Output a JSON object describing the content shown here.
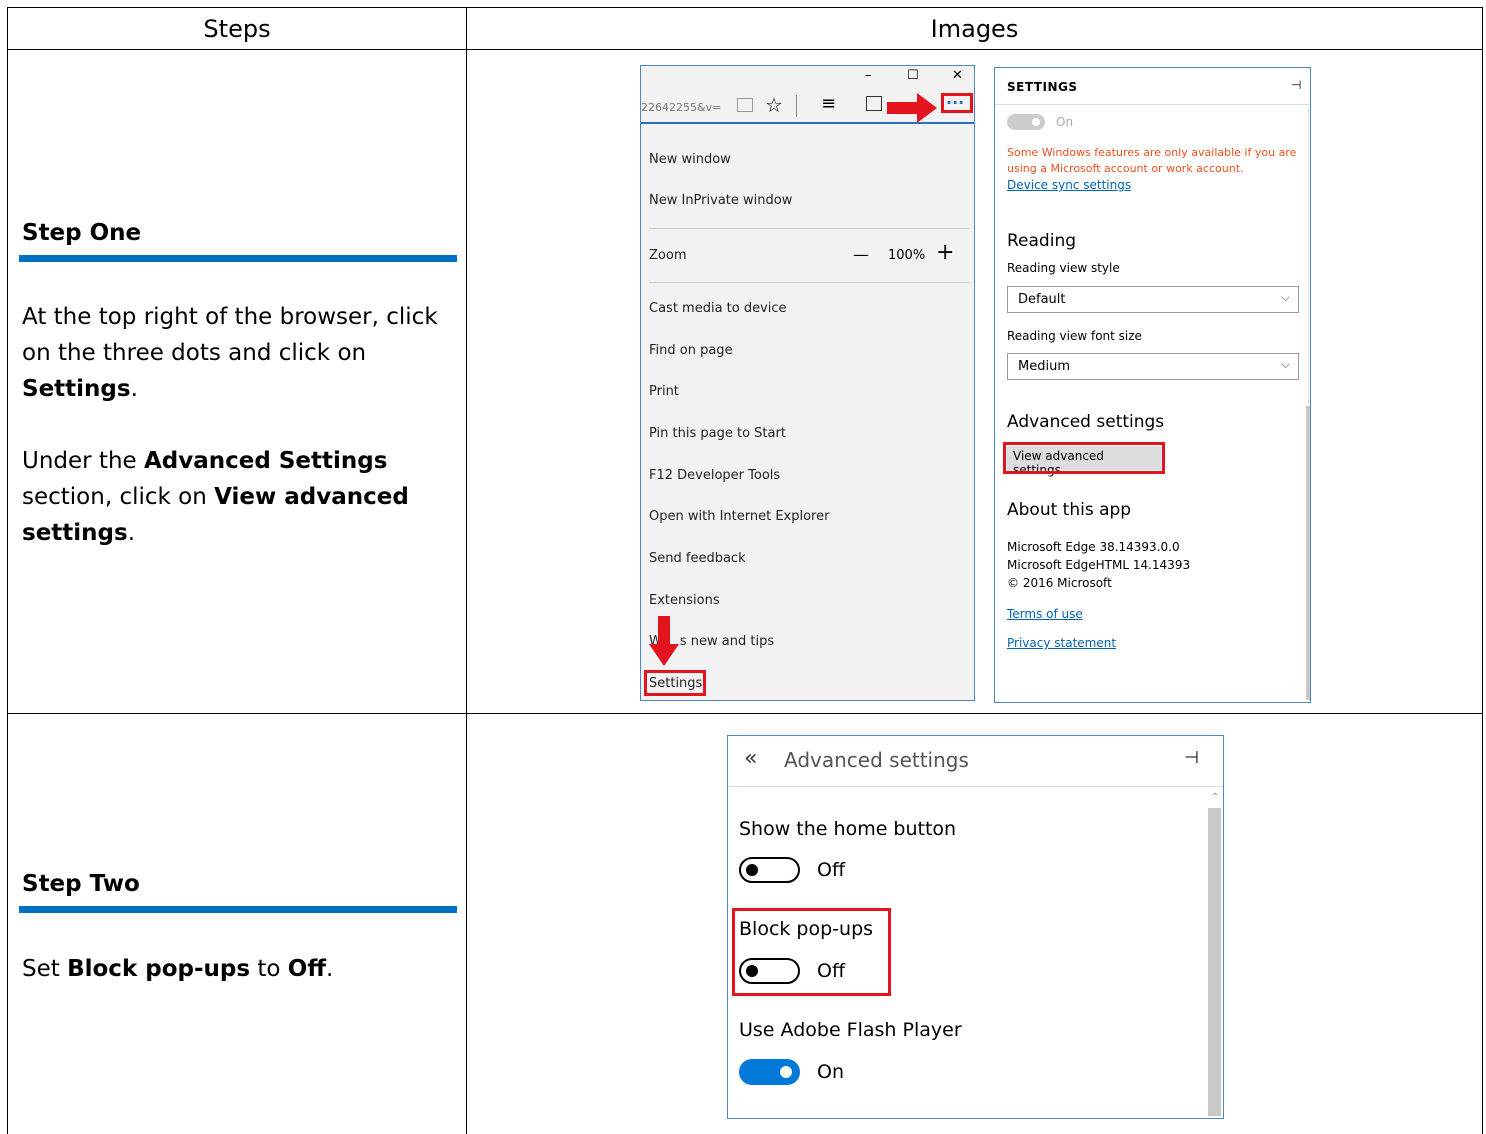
{
  "table": {
    "headers": [
      "Steps",
      "Images"
    ]
  },
  "step_one": {
    "heading": "Step One",
    "p1_pre": "At the top right of the browser, click on the three dots and click on ",
    "p1_bold": "Settings",
    "p1_post": ".",
    "p2_pre": "Under the ",
    "p2_bold1": "Advanced Settings",
    "p2_mid": " section, click on ",
    "p2_bold2": "View advanced settings",
    "p2_post": "."
  },
  "step_two": {
    "heading": "Step Two",
    "pre": "Set ",
    "bold1": "Block pop-ups",
    "mid": " to ",
    "bold2": "Off",
    "post": "."
  },
  "menu_panel": {
    "window_controls": [
      "–",
      "☐",
      "✕"
    ],
    "address_fragment": "22642255&v=",
    "items": {
      "new_window": "New window",
      "new_inprivate": "New InPrivate window",
      "zoom": "Zoom",
      "zoom_minus": "—",
      "zoom_value": "100%",
      "zoom_plus": "+",
      "cast": "Cast media to device",
      "find": "Find on page",
      "print": "Print",
      "pin": "Pin this page to Start",
      "f12": "F12 Developer Tools",
      "open_ie": "Open with Internet Explorer",
      "feedback": "Send feedback",
      "extensions": "Extensions",
      "whats_new_a": "W",
      "whats_new_b": "s new and tips",
      "settings": "Settings"
    },
    "more_dots": "···"
  },
  "settings_panel": {
    "title": "SETTINGS",
    "sync_toggle_label": "On",
    "warning": "Some Windows features are only available if you are using a Microsoft account or work account.",
    "device_sync_link": "Device sync settings",
    "reading_heading": "Reading",
    "reading_style_label": "Reading view style",
    "reading_style_value": "Default",
    "font_size_label": "Reading view font size",
    "font_size_value": "Medium",
    "advanced_heading": "Advanced settings",
    "view_advanced_button": "View advanced settings",
    "about_heading": "About this app",
    "about_line1": "Microsoft Edge 38.14393.0.0",
    "about_line2": "Microsoft EdgeHTML 14.14393",
    "about_line3": "© 2016 Microsoft",
    "terms_link": "Terms of use",
    "privacy_link": "Privacy statement",
    "warning_color": "#e8501f",
    "link_color": "#0063b1"
  },
  "advanced_panel": {
    "back_glyph": "«",
    "title": "Advanced settings",
    "home_label": "Show the home button",
    "home_state": "Off",
    "popups_label": "Block pop-ups",
    "popups_state": "Off",
    "flash_label": "Use Adobe Flash Player",
    "flash_state": "On",
    "accent_color": "#0078d7"
  },
  "highlight_color": "#e3141e",
  "rule_color": "#0070c0"
}
